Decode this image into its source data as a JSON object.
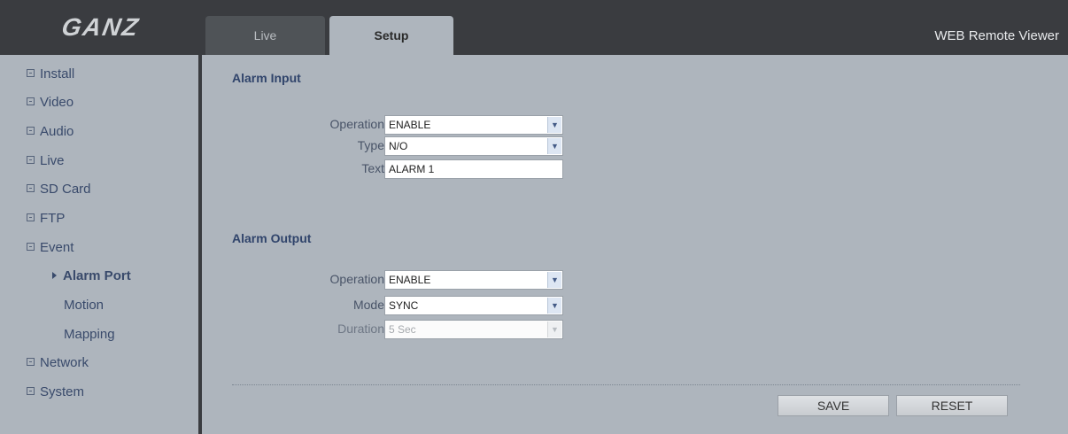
{
  "header": {
    "logo_text": "GANZ",
    "tabs": [
      {
        "label": "Live",
        "active": false
      },
      {
        "label": "Setup",
        "active": true
      }
    ],
    "app_title": "WEB Remote Viewer"
  },
  "sidebar": {
    "items": [
      {
        "label": "Install"
      },
      {
        "label": "Video"
      },
      {
        "label": "Audio"
      },
      {
        "label": "Live"
      },
      {
        "label": "SD Card"
      },
      {
        "label": "FTP"
      },
      {
        "label": "Event"
      },
      {
        "label": "Network"
      },
      {
        "label": "System"
      }
    ],
    "event_subitems": [
      {
        "label": "Alarm Port",
        "active": true
      },
      {
        "label": "Motion",
        "active": false
      },
      {
        "label": "Mapping",
        "active": false
      }
    ]
  },
  "alarm_input": {
    "title": "Alarm Input",
    "operation": {
      "label": "Operation",
      "value": "ENABLE"
    },
    "type": {
      "label": "Type",
      "value": "N/O"
    },
    "text": {
      "label": "Text",
      "value": "ALARM 1"
    }
  },
  "alarm_output": {
    "title": "Alarm Output",
    "operation": {
      "label": "Operation",
      "value": "ENABLE"
    },
    "mode": {
      "label": "Mode",
      "value": "SYNC"
    },
    "duration": {
      "label": "Duration",
      "value": "5 Sec",
      "disabled": true
    }
  },
  "buttons": {
    "save": "SAVE",
    "reset": "RESET"
  },
  "colors": {
    "header_bg": "#3a3c40",
    "panel_bg": "#aeb5bd",
    "link_text": "#394a6b",
    "section_title": "#30446b"
  }
}
